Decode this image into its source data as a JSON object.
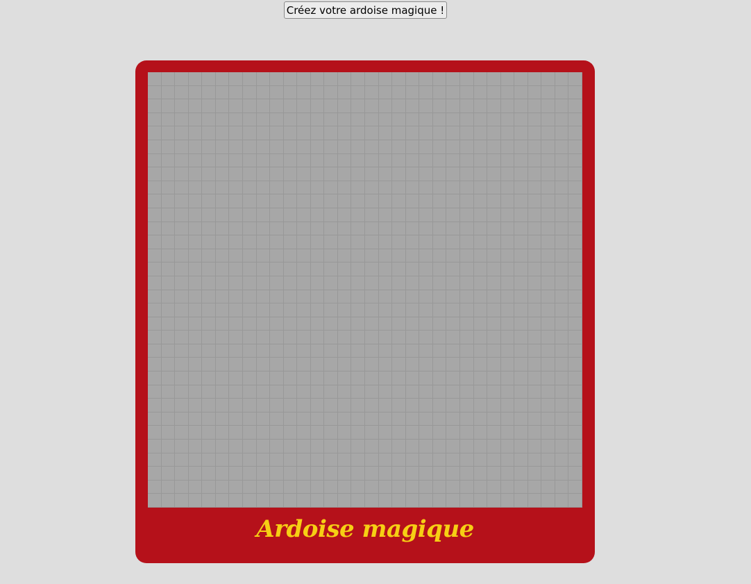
{
  "toolbar": {
    "create_label": "Créez votre ardoise magique !"
  },
  "slate": {
    "title": "Ardoise magique",
    "grid_columns": 32,
    "grid_rows": 32,
    "colors": {
      "page_background": "#dedede",
      "frame": "#b5111a",
      "cell": "#a7a7a7",
      "cell_border": "#989898",
      "title": "#f6cf14"
    }
  }
}
